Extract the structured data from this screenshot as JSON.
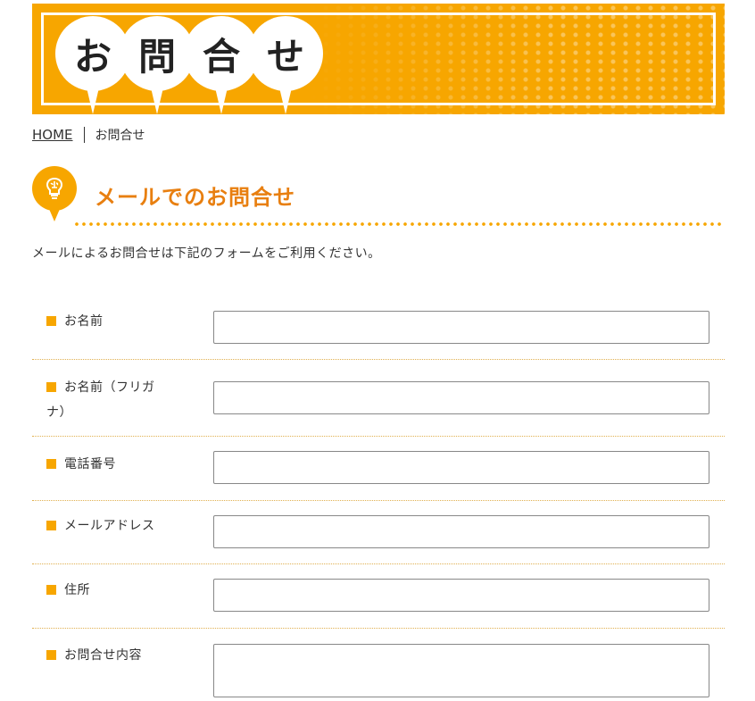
{
  "banner": {
    "chars": [
      "お",
      "問",
      "合",
      "せ"
    ]
  },
  "breadcrumb": {
    "home": "HOME",
    "current": "お問合せ"
  },
  "section": {
    "icon": "brain-bulb-icon",
    "title": "メールでのお問合せ",
    "intro": "メールによるお問合せは下記のフォームをご利用ください。"
  },
  "form": {
    "fields": [
      {
        "label": "お名前"
      },
      {
        "label_line1": "お名前（フリガ",
        "label_line2": "ナ）"
      },
      {
        "label": "電話番号"
      },
      {
        "label": "メールアドレス"
      },
      {
        "label": "住所"
      },
      {
        "label": "お問合せ内容"
      }
    ]
  },
  "colors": {
    "accent": "#f7a600",
    "title": "#e87f10"
  }
}
